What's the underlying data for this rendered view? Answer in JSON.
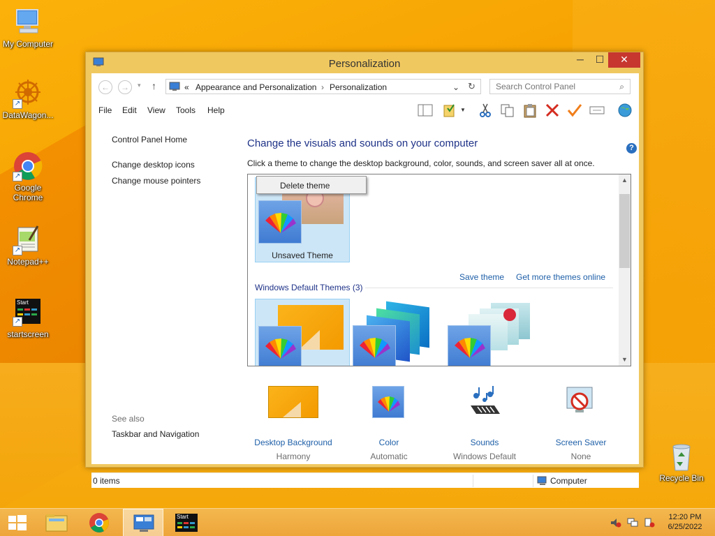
{
  "desktop": {
    "icons": [
      {
        "label": "My Computer"
      },
      {
        "label": "DataWagon..."
      },
      {
        "label": "Google Chrome"
      },
      {
        "label": "Notepad++"
      },
      {
        "label": "startscreen"
      },
      {
        "label": "Recycle Bin"
      }
    ],
    "startscreen_tile_label": "Start"
  },
  "window": {
    "title": "Personalization",
    "controls": {
      "minimize": "─",
      "maximize": "☐",
      "close": "✕"
    },
    "address": {
      "prefix": "«",
      "crumbs": [
        "Appearance and Personalization",
        "Personalization"
      ]
    },
    "search_placeholder": "Search Control Panel",
    "menu": [
      "File",
      "Edit",
      "View",
      "Tools",
      "Help"
    ],
    "left_pane": {
      "home": "Control Panel Home",
      "links": [
        "Change desktop icons",
        "Change mouse pointers"
      ],
      "see_also_title": "See also",
      "see_also_links": [
        "Taskbar and Navigation"
      ]
    },
    "main": {
      "heading": "Change the visuals and sounds on your computer",
      "subtext": "Click a theme to change the desktop background, color, sounds, and screen saver all at once.",
      "context_menu_item": "Delete theme",
      "unsaved_theme_label": "Unsaved Theme",
      "save_theme": "Save theme",
      "get_more_themes": "Get more themes online",
      "default_group_title": "Windows Default Themes (3)"
    },
    "bottom_items": [
      {
        "label": "Desktop Background",
        "value": "Harmony"
      },
      {
        "label": "Color",
        "value": "Automatic"
      },
      {
        "label": "Sounds",
        "value": "Windows Default"
      },
      {
        "label": "Screen Saver",
        "value": "None"
      }
    ],
    "status": {
      "items": "0 items",
      "location": "Computer"
    }
  },
  "taskbar": {
    "start_tile_label": "Start",
    "clock_time": "12:20 PM",
    "clock_date": "6/25/2022"
  },
  "colors": {
    "accent_link": "#1e5fa8",
    "heading": "#1e3287",
    "window_frame": "#f0c860",
    "close_button": "#c7372f"
  }
}
